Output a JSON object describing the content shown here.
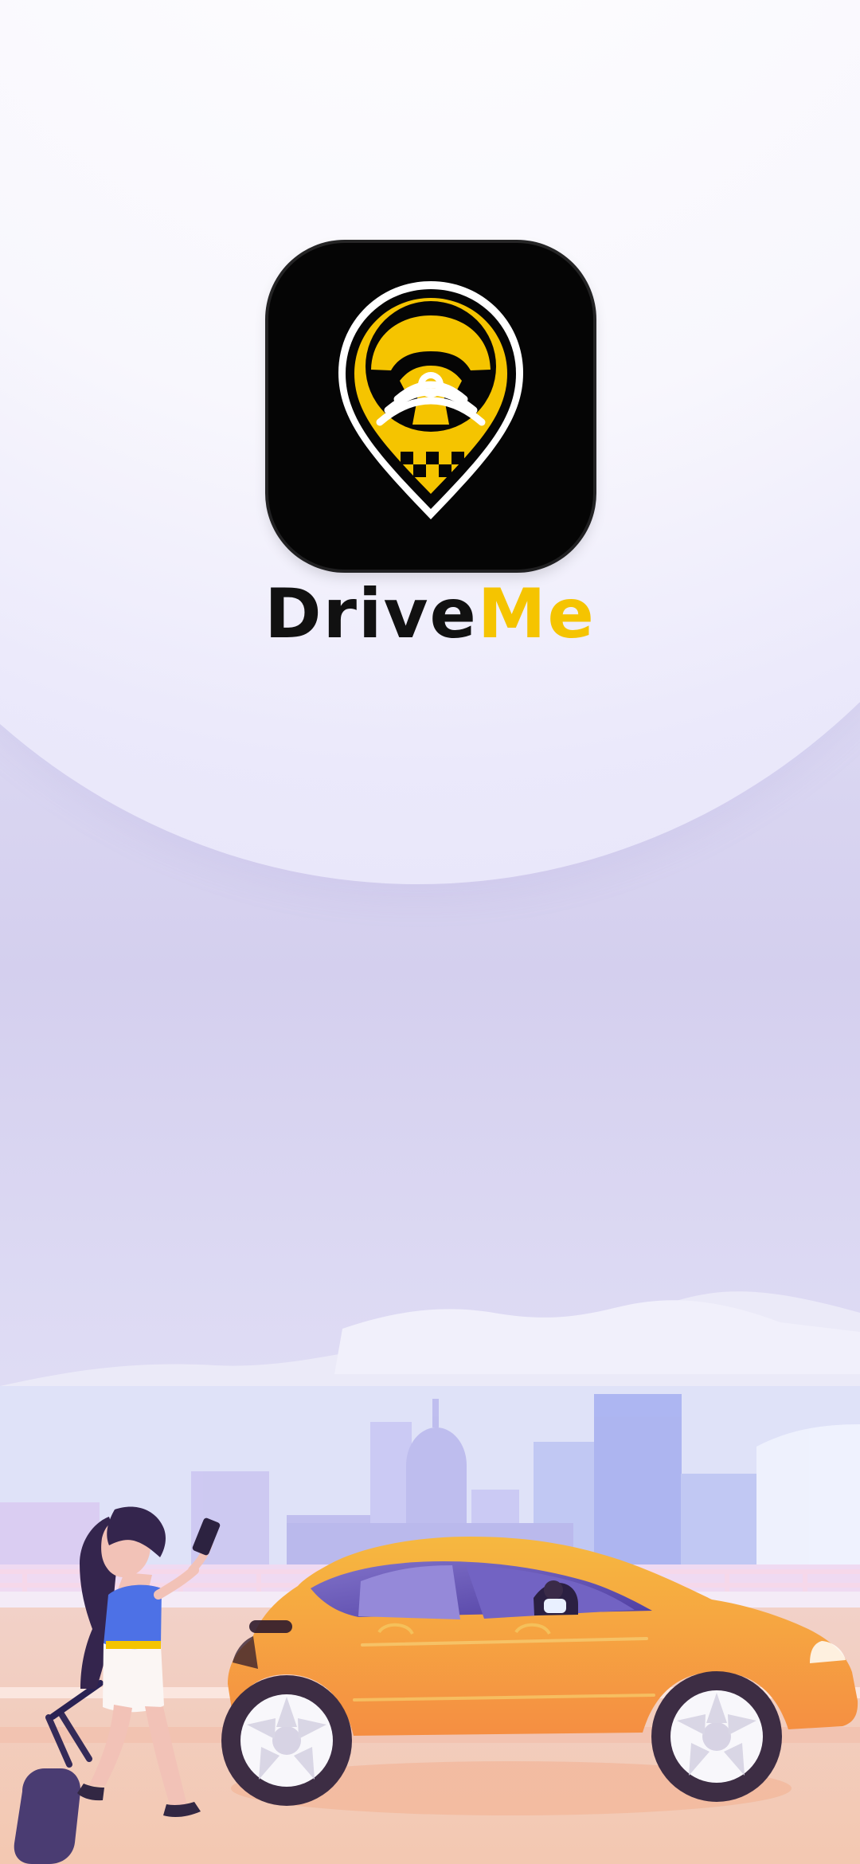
{
  "app": {
    "brand_primary": "Drive",
    "brand_accent": "Me"
  },
  "logo": {
    "icon": "location-pin-steering-wheel-icon"
  },
  "colors": {
    "background": "#dcd9f3",
    "accent_yellow": "#f5c400",
    "logo_background": "#050505",
    "text_dark": "#111111",
    "car_body": "#f6b33a",
    "skyline": "#b8b6ef"
  }
}
